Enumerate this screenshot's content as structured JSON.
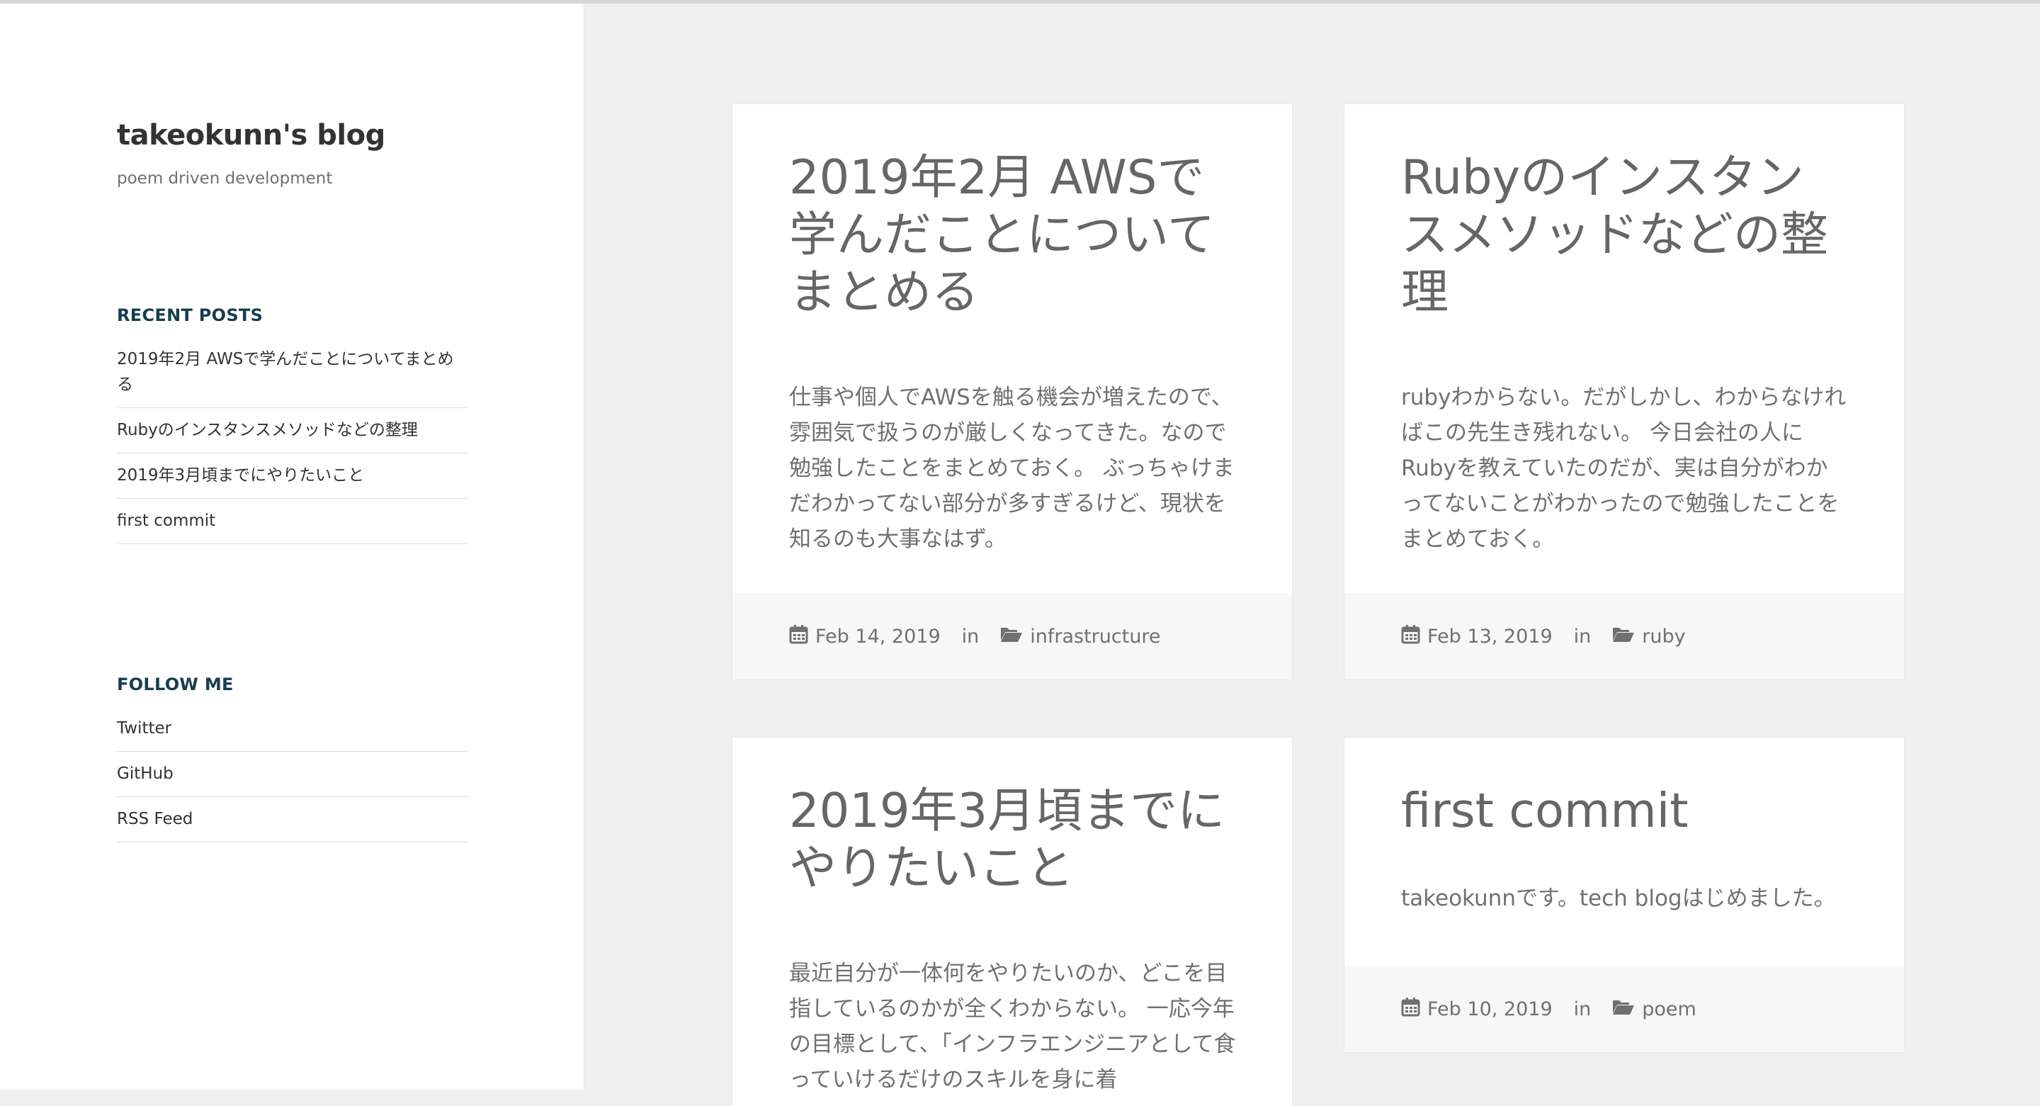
{
  "site": {
    "title": "takeokunn's blog",
    "description": "poem driven development"
  },
  "sidebar": {
    "recent_posts": {
      "title": "RECENT POSTS",
      "items": [
        "2019年2月 AWSで学んだことについてまとめる",
        "Rubyのインスタンスメソッドなどの整理",
        "2019年3月頃までにやりたいこと",
        "first commit"
      ]
    },
    "follow_me": {
      "title": "FOLLOW ME",
      "items": [
        "Twitter",
        "GitHub",
        "RSS Feed"
      ]
    }
  },
  "posts": [
    {
      "title": "2019年2月 AWSで学んだことについてまとめる",
      "excerpt": "仕事や個人でAWSを触る機会が増えたので、雰囲気で扱うのが厳しくなってきた。なので勉強したことをまとめておく。 ぶっちゃけまだわかってない部分が多すぎるけど、現状を知るのも大事なはず。",
      "date": "Feb 14, 2019",
      "in_label": "in",
      "category": "infrastructure"
    },
    {
      "title": "Rubyのインスタンスメソッドなどの整理",
      "excerpt": "rubyわからない。だがしかし、わからなければこの先生き残れない。 今日会社の人にRubyを教えていたのだが、実は自分がわかってないことがわかったので勉強したことをまとめておく。",
      "date": "Feb 13, 2019",
      "in_label": "in",
      "category": "ruby"
    },
    {
      "title": "2019年3月頃までにやりたいこと",
      "excerpt": "最近自分が一体何をやりたいのか、どこを目指しているのかが全くわからない。 一応今年の目標として、「インフラエンジニアとして食っていけるだけのスキルを身に着"
    },
    {
      "title": "first commit",
      "excerpt": "takeokunnです。tech blogはじめました。",
      "date": "Feb 10, 2019",
      "in_label": "in",
      "category": "poem"
    }
  ],
  "icons": {
    "calendar": "calendar-icon",
    "folder": "folder-open-icon"
  }
}
